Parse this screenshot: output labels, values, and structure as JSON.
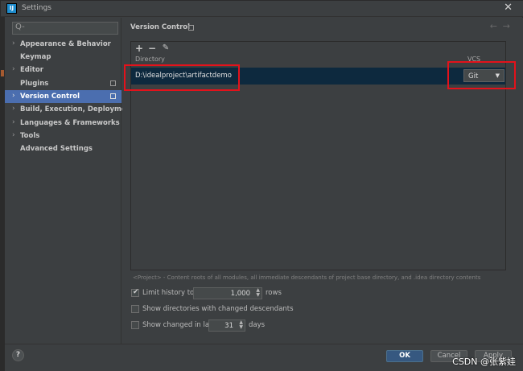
{
  "window": {
    "title": "Settings",
    "app_icon_text": "IJ"
  },
  "sidebar": {
    "search_placeholder": "Q-",
    "items": [
      {
        "label": "Appearance & Behavior",
        "arrow": true,
        "badge": false,
        "selected": false
      },
      {
        "label": "Keymap",
        "arrow": false,
        "badge": false,
        "selected": false
      },
      {
        "label": "Editor",
        "arrow": true,
        "badge": false,
        "selected": false
      },
      {
        "label": "Plugins",
        "arrow": false,
        "badge": true,
        "selected": false
      },
      {
        "label": "Version Control",
        "arrow": true,
        "badge": true,
        "selected": true
      },
      {
        "label": "Build, Execution, Deployment",
        "arrow": true,
        "badge": false,
        "selected": false
      },
      {
        "label": "Languages & Frameworks",
        "arrow": true,
        "badge": false,
        "selected": false
      },
      {
        "label": "Tools",
        "arrow": true,
        "badge": false,
        "selected": false
      },
      {
        "label": "Advanced Settings",
        "arrow": false,
        "badge": false,
        "selected": false
      }
    ]
  },
  "main": {
    "title": "Version Control",
    "toolbar": {
      "add": "+",
      "remove": "−",
      "edit": "✎"
    },
    "columns": {
      "directory": "Directory",
      "vcs": "VCS"
    },
    "rows": [
      {
        "directory": "D:\\idealproject\\artifactdemo",
        "vcs": "Git"
      }
    ],
    "hint": "<Project> - Content roots of all modules, all immediate descendants of project base directory, and .idea directory contents",
    "options": {
      "limit_history": {
        "label": "Limit history to:",
        "checked": true,
        "value": "1,000",
        "suffix": "rows"
      },
      "show_dirs": {
        "label": "Show directories with changed descendants",
        "checked": false
      },
      "show_changed": {
        "label": "Show changed in last",
        "checked": false,
        "value": "31",
        "suffix": "days"
      }
    }
  },
  "footer": {
    "help": "?",
    "ok": "OK",
    "cancel": "Cancel",
    "apply": "Apply"
  },
  "watermark": "CSDN @张紫娃",
  "colors": {
    "selection": "#4b6eaf",
    "row_selected": "#0d293e",
    "highlight": "#e3121b",
    "ok_button": "#365880"
  }
}
